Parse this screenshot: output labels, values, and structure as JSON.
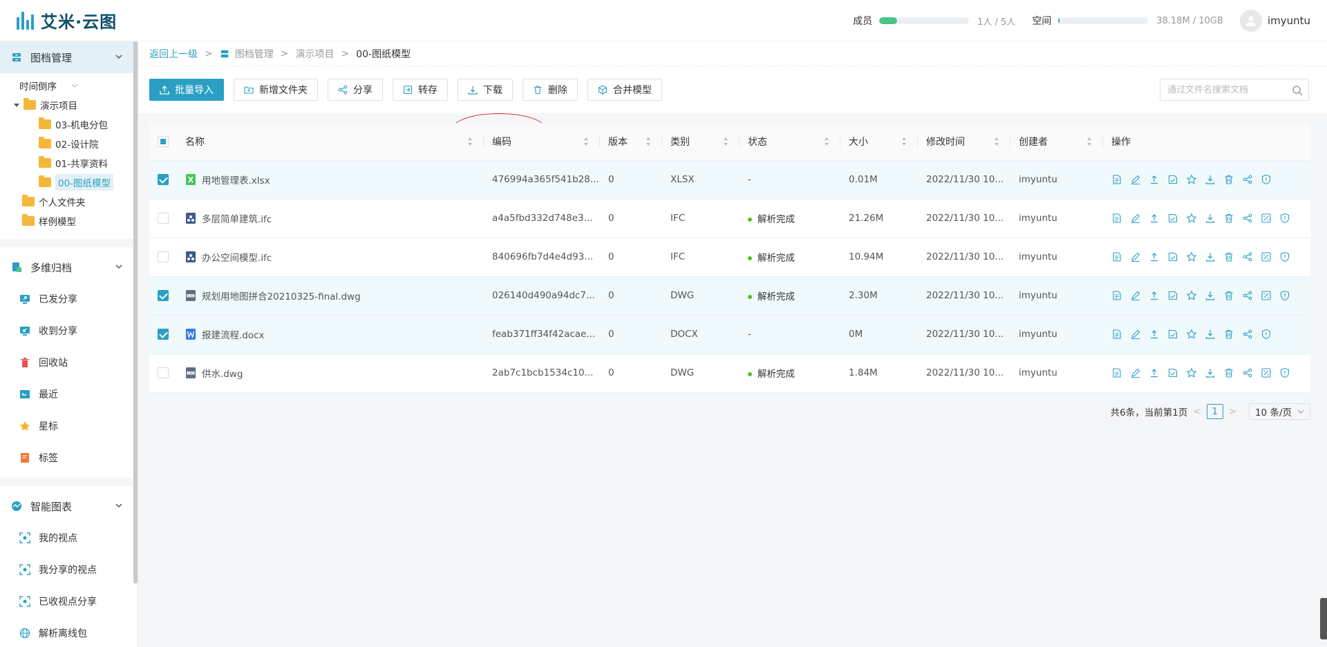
{
  "header": {
    "logo_text": "艾米·云图",
    "members_label": "成员",
    "members_value": "1人 / 5人",
    "members_progress": 0.2,
    "space_label": "空间",
    "space_value": "38.18M / 10GB",
    "space_progress": 0.004,
    "username": "imyuntu"
  },
  "sidebar": {
    "section_archive": "图档管理",
    "sort_label": "时间倒序",
    "tree": {
      "root": "演示项目",
      "children": [
        "03-机电分包",
        "02-设计院",
        "01-共享资料",
        "00-图纸模型"
      ],
      "personal": "个人文件夹",
      "sample": "样例模型"
    },
    "section_multi": "多维归档",
    "multi_items": [
      "已发分享",
      "收到分享",
      "回收站",
      "最近",
      "星标",
      "标签"
    ],
    "section_smart": "智能图表",
    "smart_items": [
      "我的视点",
      "我分享的视点",
      "已收视点分享",
      "解析离线包"
    ]
  },
  "breadcrumb": {
    "back": "返回上一级",
    "sep": ">",
    "root": "图档管理",
    "project": "演示项目",
    "current": "00-图纸模型"
  },
  "toolbar": {
    "import": "批量导入",
    "new_folder": "新增文件夹",
    "share": "分享",
    "transfer": "转存",
    "download": "下载",
    "delete": "删除",
    "merge": "合并模型",
    "search_placeholder": "通过文件名搜索文档"
  },
  "table": {
    "columns": [
      "名称",
      "编码",
      "版本",
      "类别",
      "状态",
      "大小",
      "修改时间",
      "创建者",
      "操作"
    ],
    "rows": [
      {
        "checked": true,
        "icon": "xlsx",
        "name": "用地管理表.xlsx",
        "code": "476994a365f541b28...",
        "version": "0",
        "type": "XLSX",
        "status": "-",
        "parsed": false,
        "size": "0.01M",
        "time": "2022/11/30 10...",
        "creator": "imyuntu",
        "ops": 9
      },
      {
        "checked": false,
        "icon": "ifc",
        "name": "多层简单建筑.ifc",
        "code": "a4a5fbd332d748e3...",
        "version": "0",
        "type": "IFC",
        "status": "解析完成",
        "parsed": true,
        "size": "21.26M",
        "time": "2022/11/30 10...",
        "creator": "imyuntu",
        "ops": 10
      },
      {
        "checked": false,
        "icon": "ifc",
        "name": "办公空间模型.ifc",
        "code": "840696fb7d4e4d93...",
        "version": "0",
        "type": "IFC",
        "status": "解析完成",
        "parsed": true,
        "size": "10.94M",
        "time": "2022/11/30 10...",
        "creator": "imyuntu",
        "ops": 10
      },
      {
        "checked": true,
        "icon": "dwg",
        "name": "规划用地图拼合20210325-final.dwg",
        "code": "026140d490a94dc7...",
        "version": "0",
        "type": "DWG",
        "status": "解析完成",
        "parsed": true,
        "size": "2.30M",
        "time": "2022/11/30 10...",
        "creator": "imyuntu",
        "ops": 10
      },
      {
        "checked": true,
        "icon": "docx",
        "name": "报建流程.docx",
        "code": "feab371ff34f42acae...",
        "version": "0",
        "type": "DOCX",
        "status": "-",
        "parsed": false,
        "size": "0M",
        "time": "2022/11/30 10...",
        "creator": "imyuntu",
        "ops": 9
      },
      {
        "checked": false,
        "icon": "dwg",
        "name": "供水.dwg",
        "code": "2ab7c1bcb1534c10...",
        "version": "0",
        "type": "DWG",
        "status": "解析完成",
        "parsed": true,
        "size": "1.84M",
        "time": "2022/11/30 10...",
        "creator": "imyuntu",
        "ops": 10
      }
    ]
  },
  "pagination": {
    "summary": "共6条，当前第1页",
    "prev": "<",
    "current": "1",
    "next": ">",
    "page_size": "10 条/页"
  },
  "colors": {
    "accent": "#2b9fc3",
    "success": "#52c41a",
    "member_bar": "#4cc38a",
    "annotation": "#dd2222"
  }
}
